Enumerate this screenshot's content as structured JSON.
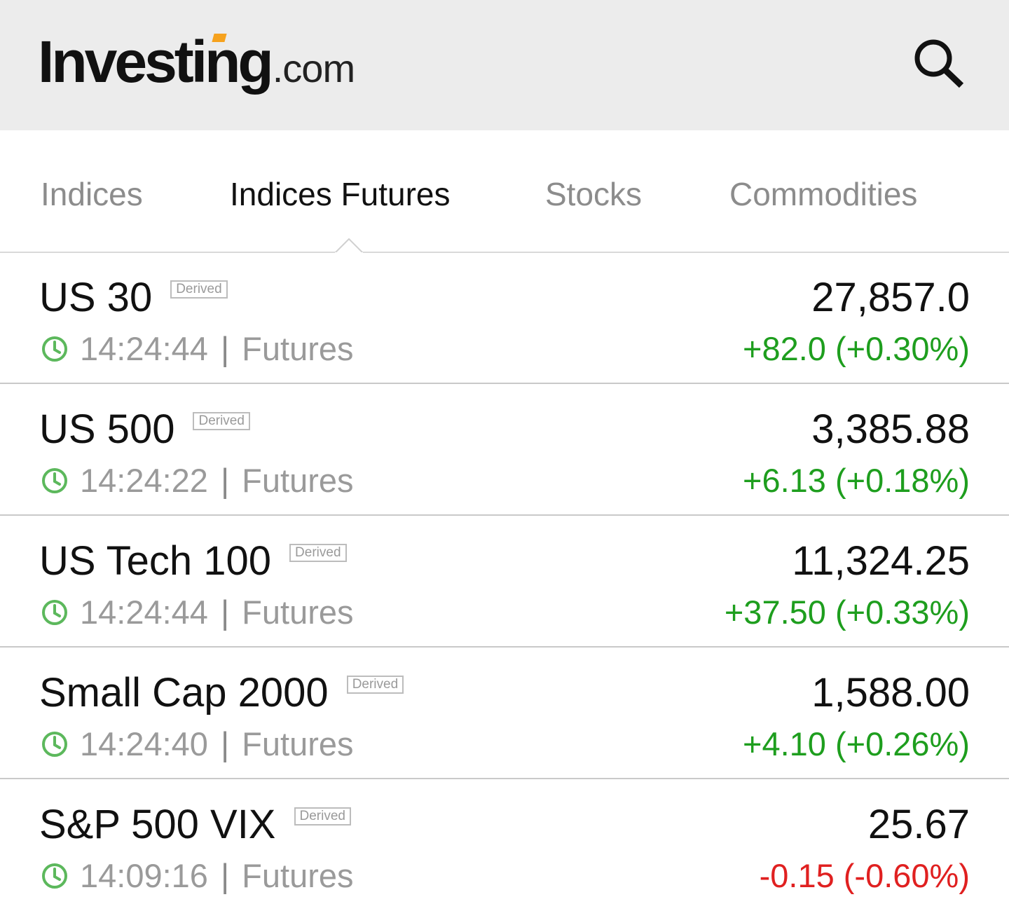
{
  "header": {
    "logo_text": "Investing",
    "logo_suffix": ".com",
    "search_icon": "search-icon"
  },
  "tabs": [
    {
      "label": "Indices",
      "active": false
    },
    {
      "label": "Indices Futures",
      "active": true
    },
    {
      "label": "Stocks",
      "active": false
    },
    {
      "label": "Commodities",
      "active": false
    }
  ],
  "colors": {
    "up": "#1e9e1e",
    "down": "#e02020",
    "clock": "#5cb85c",
    "header_bg": "#ececec"
  },
  "rows": [
    {
      "name": "US 30",
      "badge": "Derived",
      "time": "14:24:44",
      "type": "Futures",
      "price": "27,857.0",
      "change": "+82.0 (+0.30%)",
      "direction": "up"
    },
    {
      "name": "US 500",
      "badge": "Derived",
      "time": "14:24:22",
      "type": "Futures",
      "price": "3,385.88",
      "change": "+6.13 (+0.18%)",
      "direction": "up"
    },
    {
      "name": "US Tech 100",
      "badge": "Derived",
      "time": "14:24:44",
      "type": "Futures",
      "price": "11,324.25",
      "change": "+37.50 (+0.33%)",
      "direction": "up"
    },
    {
      "name": "Small Cap 2000",
      "badge": "Derived",
      "time": "14:24:40",
      "type": "Futures",
      "price": "1,588.00",
      "change": "+4.10 (+0.26%)",
      "direction": "up"
    },
    {
      "name": "S&P 500 VIX",
      "badge": "Derived",
      "time": "14:09:16",
      "type": "Futures",
      "price": "25.67",
      "change": "-0.15 (-0.60%)",
      "direction": "down"
    }
  ]
}
